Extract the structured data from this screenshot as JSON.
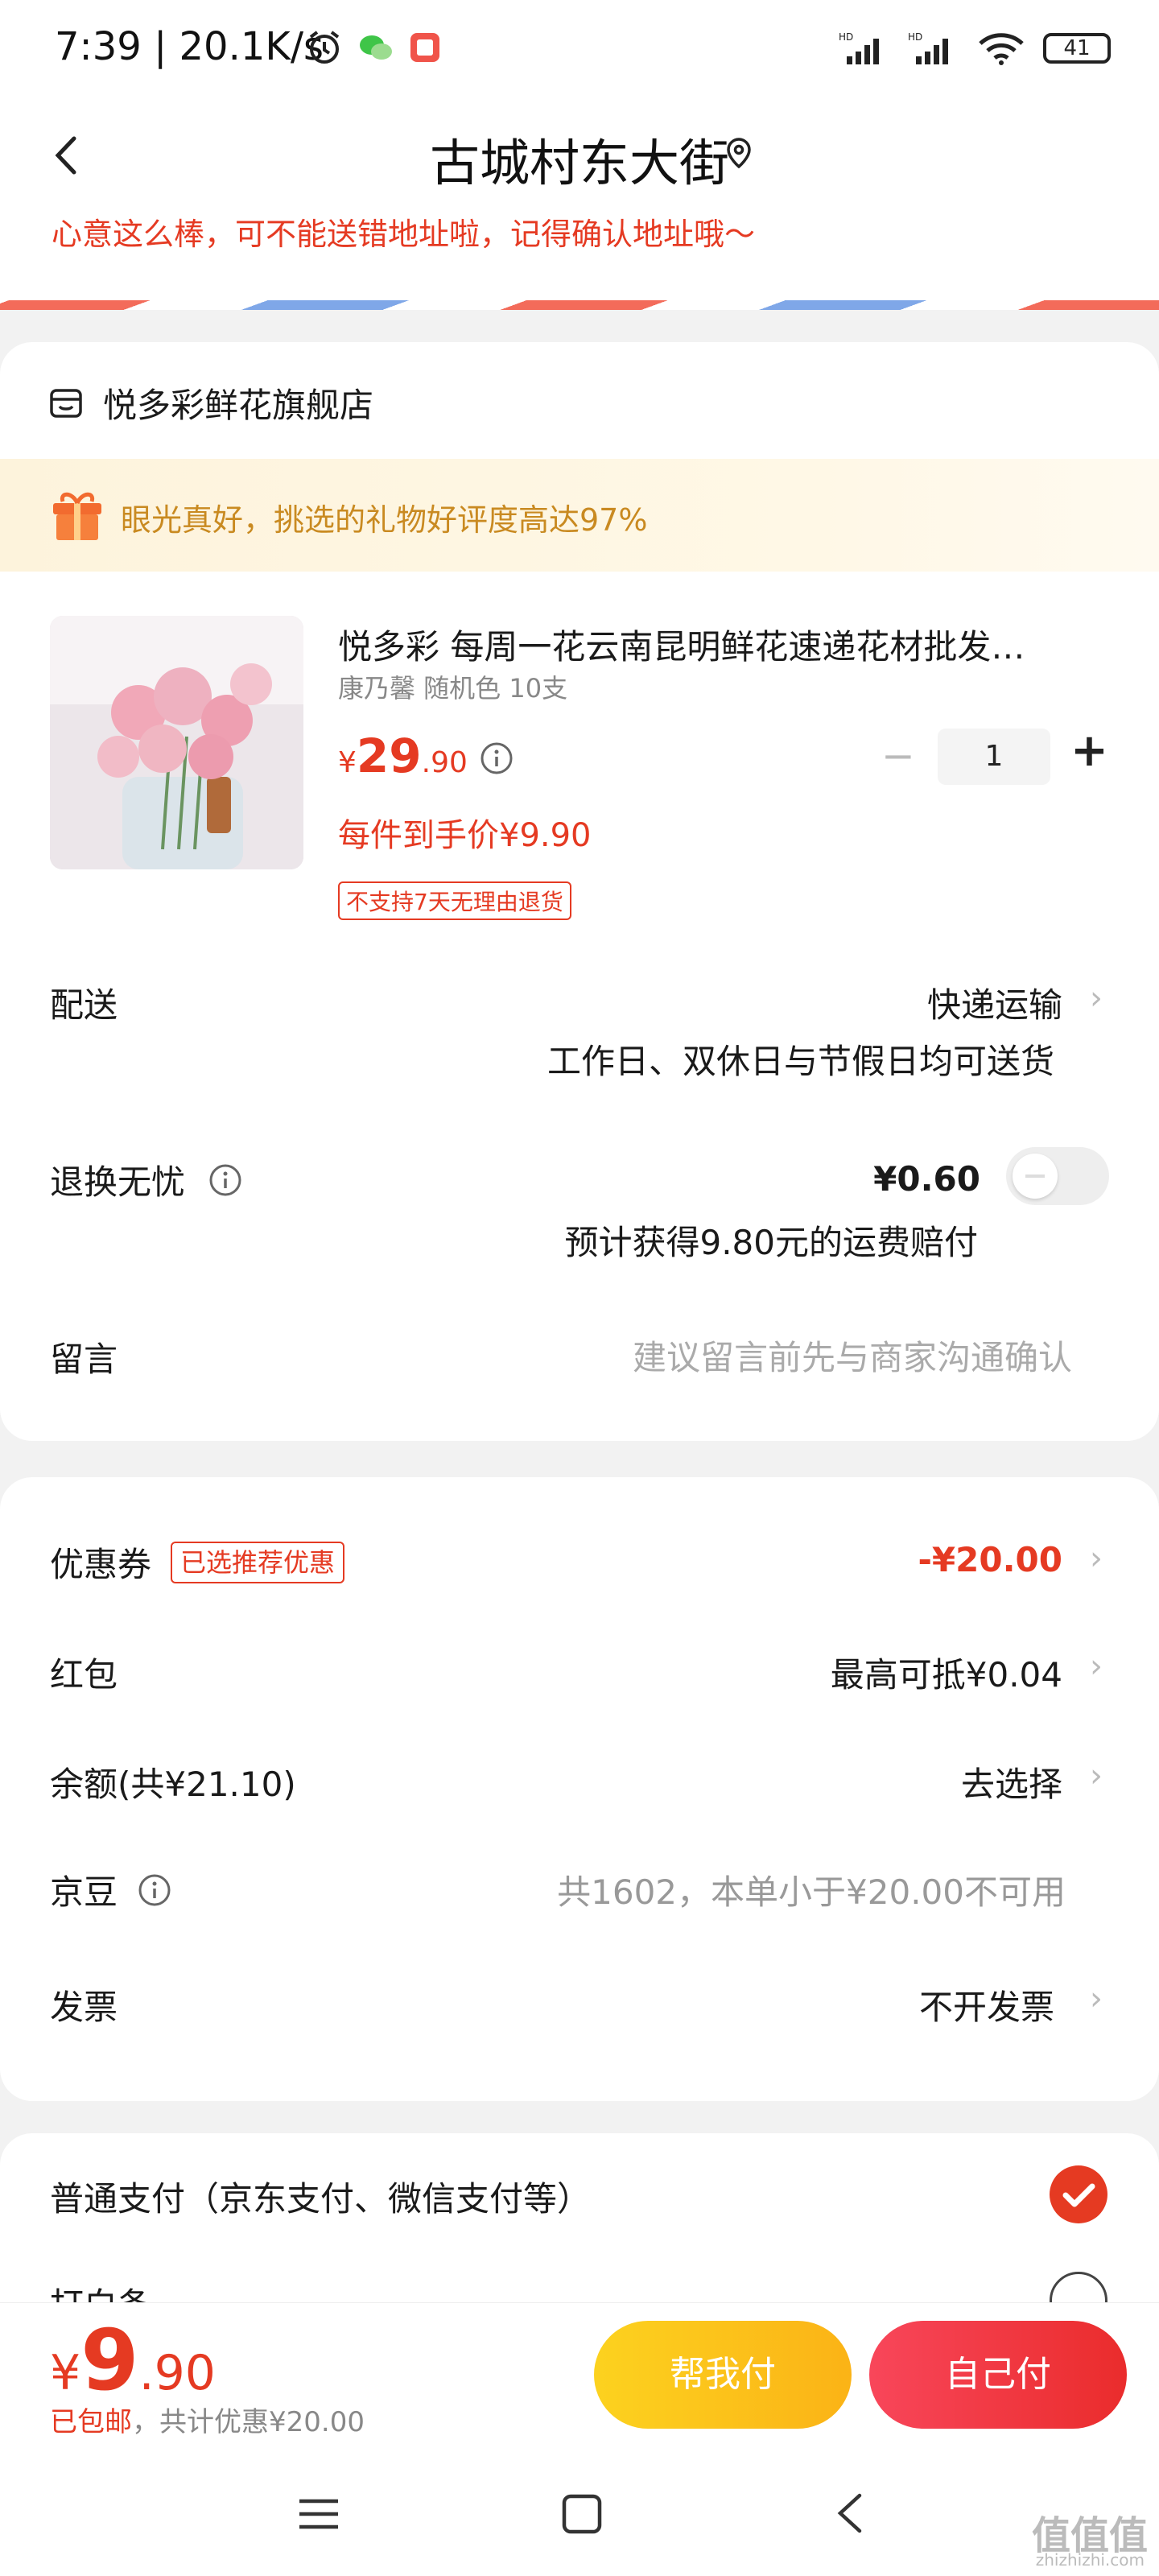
{
  "status_bar": {
    "time": "7:39",
    "speed": "20.1K/s",
    "battery": "41"
  },
  "header": {
    "title": "古城村东大街"
  },
  "address_tip": "心意这么棒，可不能送错地址啦，记得确认地址哦～",
  "shop": {
    "name": "悦多彩鲜花旗舰店"
  },
  "gift_banner": {
    "text": "眼光真好，挑选的礼物好评度高达97%"
  },
  "product": {
    "title": "悦多彩 每周一花云南昆明鲜花速递花材批发…",
    "spec": "康乃馨 随机色 10支",
    "price_currency": "¥",
    "price_int": "29",
    "price_dec": ".90",
    "unit_price": "每件到手价¥9.90",
    "no_return": "不支持7天无理由退货",
    "quantity": "1",
    "minus": "−",
    "plus": "+"
  },
  "delivery": {
    "label": "配送",
    "method": "快递运输",
    "note": "工作日、双休日与节假日均可送货"
  },
  "return_insurance": {
    "label": "退换无忧",
    "price": "¥0.60",
    "note": "预计获得9.80元的运费赔付",
    "enabled": false
  },
  "message": {
    "label": "留言",
    "placeholder": "建议留言前先与商家沟通确认"
  },
  "discounts": {
    "coupon_label": "优惠券",
    "coupon_tag": "已选推荐优惠",
    "coupon_value": "-¥20.00",
    "redpacket_label": "红包",
    "redpacket_value": "最高可抵¥0.04",
    "balance_label": "余额(共¥21.10)",
    "balance_value": "去选择",
    "jingdou_label": "京豆",
    "jingdou_value": "共1602，本单小于¥20.00不可用",
    "invoice_label": "发票",
    "invoice_value": "不开发票"
  },
  "payment": {
    "normal_label": "普通支付（京东支付、微信支付等）",
    "normal_selected": true,
    "baitiao_label": "打白条",
    "baitiao_selected": false
  },
  "bottom_bar": {
    "currency": "¥",
    "total_int": "9",
    "total_dec": ".90",
    "shipping_free": "已包邮",
    "discount_note": "，共计优惠¥20.00",
    "help_pay": "帮我付",
    "self_pay": "自己付"
  },
  "watermark": {
    "text": "值值值",
    "sub": "zhizhizhi.com"
  },
  "colors": {
    "accent": "#e53a22",
    "gold": "#c98a21",
    "help_btn": "#fbc11a",
    "self_btn": "#f03a3f"
  }
}
